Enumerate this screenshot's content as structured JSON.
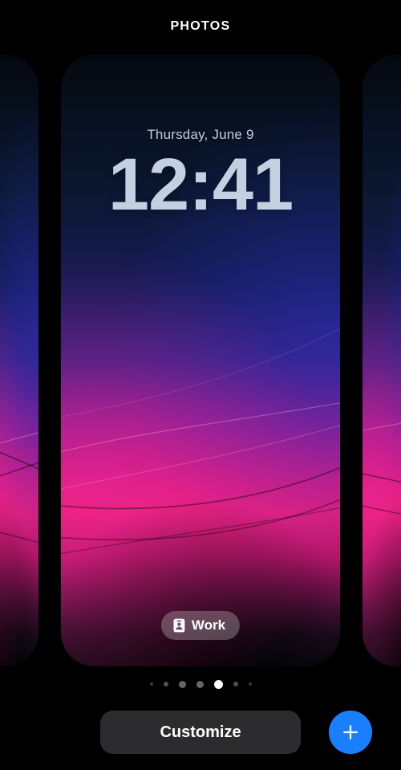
{
  "header": {
    "title": "PHOTOS"
  },
  "carousel": {
    "active_index": 4,
    "total_pages": 7,
    "preview": {
      "date": "Thursday, June 9",
      "time": "12:41",
      "focus": {
        "label": "Work",
        "icon": "badge-id-icon"
      },
      "wallpaper_name": "abstract-gradient-magenta-indigo"
    },
    "peek_left": {
      "wallpaper_name": "abstract-gradient-blue-violet"
    },
    "peek_right": {
      "wallpaper_name": "abstract-gradient-magenta-pink"
    }
  },
  "bottom_bar": {
    "customize_label": "Customize",
    "add_icon": "plus-icon"
  },
  "colors": {
    "accent_blue": "#1a7fff",
    "button_gray": "#2c2c2e",
    "active_dot": "#ffffff",
    "inactive_dot": "#5a5a5c",
    "clock_text": "#c3d0e2",
    "date_text": "#c6cfdd",
    "background": "#000000"
  }
}
